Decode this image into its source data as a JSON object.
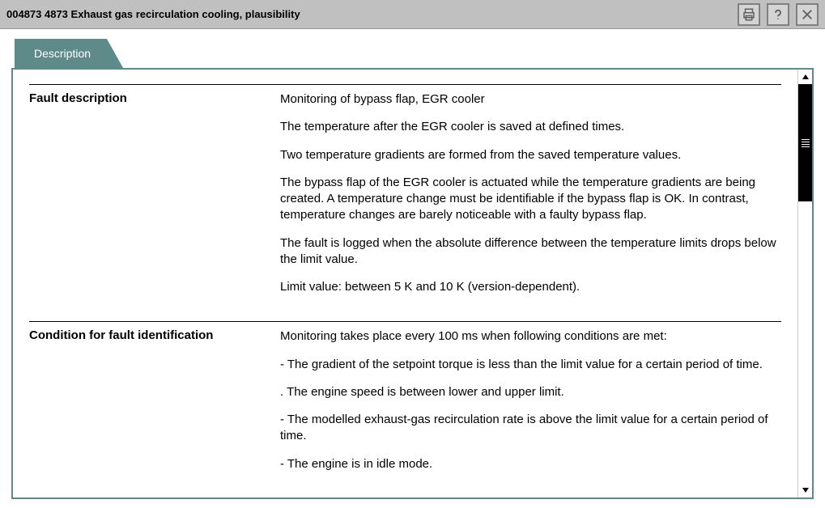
{
  "header": {
    "title": "004873 4873 Exhaust gas recirculation cooling, plausibility"
  },
  "tab": {
    "label": "Description"
  },
  "sections": [
    {
      "label": "Fault description",
      "paragraphs": [
        "Monitoring of bypass flap, EGR cooler",
        "The temperature after the EGR cooler is saved at defined times.",
        "Two temperature gradients are formed from the saved temperature values.",
        "The bypass flap of the EGR cooler is actuated while the temperature gradients are being created. A temperature change must be identifiable if the bypass flap is OK. In contrast, temperature changes are barely noticeable with a faulty bypass flap.",
        "The fault is logged when the absolute difference between the temperature limits drops below the limit value.",
        "Limit value: between 5 K and 10 K (version-dependent)."
      ]
    },
    {
      "label": "Condition for fault identification",
      "paragraphs": [
        "Monitoring takes place every 100 ms when following conditions are met:",
        "- The gradient of the setpoint torque is less than the limit value for a certain period of time.",
        ". The engine speed is between lower and upper limit.",
        "- The modelled exhaust-gas recirculation rate is above the limit value for a certain period of time.",
        "- The engine is in idle mode."
      ]
    }
  ]
}
